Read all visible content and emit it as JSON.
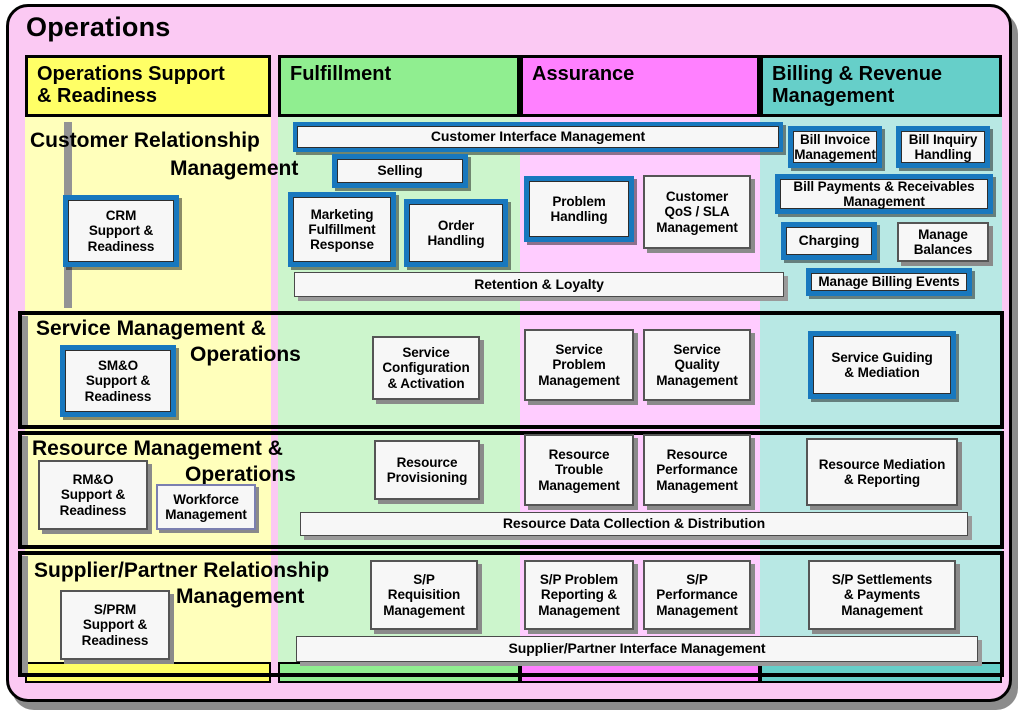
{
  "page": {
    "title": "Operations",
    "frame_color": "#fbc9f3"
  },
  "columns": [
    {
      "id": "osr",
      "label": "Operations Support\n& Readiness",
      "header_color": "#ffff66",
      "body_color": "#ffffbb",
      "foot_color": "#ffff66"
    },
    {
      "id": "fulfillment",
      "label": "Fulfillment",
      "header_color": "#90ee90",
      "body_color": "#ccf5cc",
      "foot_color": "#90ee90"
    },
    {
      "id": "assurance",
      "label": "Assurance",
      "header_color": "#ff80ff",
      "body_color": "#ffccff",
      "foot_color": "#ff80ff"
    },
    {
      "id": "billing",
      "label": "Billing & Revenue\nManagement",
      "header_color": "#66cfc9",
      "body_color": "#b8e8e4",
      "foot_color": "#66cfc9"
    }
  ],
  "rows": [
    {
      "id": "crm",
      "title_line1": "Customer Relationship",
      "title_line2": "Management"
    },
    {
      "id": "smo",
      "title_line1": "Service Management &",
      "title_line2": "Operations"
    },
    {
      "id": "rmo",
      "title_line1": "Resource Management &",
      "title_line2": "Operations"
    },
    {
      "id": "sprm",
      "title_line1": "Supplier/Partner  Relationship",
      "title_line2": "Management"
    }
  ],
  "boxes": {
    "crm_support": "CRM\nSupport &\nReadiness",
    "customer_interface_management": "Customer Interface Management",
    "selling": "Selling",
    "marketing_fulfillment_response": "Marketing\nFulfillment\nResponse",
    "order_handling": "Order\nHandling",
    "problem_handling": "Problem\nHandling",
    "customer_qos_sla": "Customer\nQoS / SLA\nManagement",
    "retention_loyalty": "Retention & Loyalty",
    "bill_invoice_management": "Bill Invoice\nManagement",
    "bill_inquiry_handling": "Bill Inquiry\nHandling",
    "bill_payments_receivables": "Bill Payments & Receivables\nManagement",
    "charging": "Charging",
    "manage_balances": "Manage\nBalances",
    "manage_billing_events": "Manage Billing Events",
    "smo_support": "SM&O\nSupport &\nReadiness",
    "service_config_activation": "Service\nConfiguration\n& Activation",
    "service_problem_management": "Service\nProblem\nManagement",
    "service_quality_management": "Service\nQuality\nManagement",
    "service_guiding_mediation": "Service Guiding\n& Mediation",
    "rmo_support": "RM&O\nSupport &\nReadiness",
    "workforce_management": "Workforce\nManagement",
    "resource_provisioning": "Resource\nProvisioning",
    "resource_trouble_management": "Resource\nTrouble\nManagement",
    "resource_performance_management": "Resource\nPerformance\nManagement",
    "resource_mediation_reporting": "Resource Mediation\n& Reporting",
    "resource_data_collection": "Resource Data Collection & Distribution",
    "sprm_support": "S/PRM\nSupport &\nReadiness",
    "sp_requisition_management": "S/P\nRequisition\nManagement",
    "sp_problem_reporting": "S/P Problem\nReporting &\nManagement",
    "sp_performance_management": "S/P\nPerformance\nManagement",
    "sp_settlements_payments": "S/P Settlements\n& Payments\nManagement",
    "supplier_partner_interface": "Supplier/Partner Interface Management"
  },
  "colors": {
    "accent_blue": "#1878be",
    "box_fill": "#f7f7f7",
    "shadow_gray": "#8a8a8a",
    "lavender_border": "#7b7fb0"
  }
}
